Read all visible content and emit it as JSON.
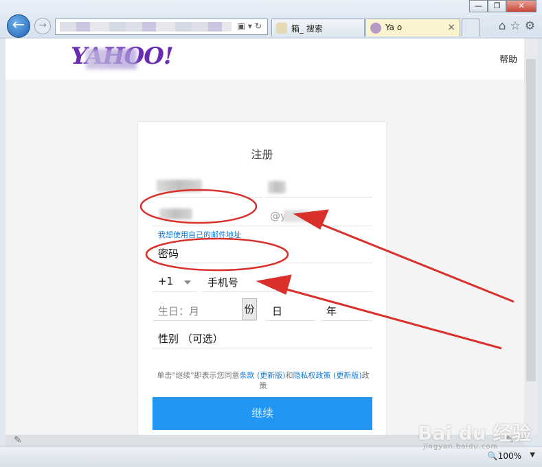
{
  "browser": {
    "window_buttons": [
      "—",
      "❐",
      "✕"
    ],
    "tabs": [
      {
        "label": "箱_  搜索",
        "active": false
      },
      {
        "label": "Ya   o",
        "active": true
      }
    ],
    "tab_close": "×",
    "tool_icons": [
      "home-icon",
      "star-icon",
      "gear-icon"
    ]
  },
  "header": {
    "logo_text": "YAHOO!",
    "help_label": "帮助",
    "brand_color": "#6a2bb3"
  },
  "form": {
    "title": "注册",
    "email_suffix": "@y    .com",
    "own_email_link": "我想使用自己的邮件地址",
    "password_placeholder": "密码",
    "country_code": "+1",
    "phone_placeholder": "手机号",
    "birth_month_placeholder": "生日：月",
    "birth_month_button": "份",
    "birth_day_placeholder": "日",
    "birth_year_placeholder": "年",
    "gender_placeholder": "性别 （可选）",
    "terms_prefix": "单击\"继续\"即表示您同意",
    "terms_link": "条款 (更新版)",
    "terms_mid": "和",
    "privacy_link": "隐私权政策 (更新版)",
    "terms_suffix": "政策",
    "continue_label": "继续",
    "button_color": "#2196f3"
  },
  "status": {
    "zoom_label": "100%"
  },
  "watermark": {
    "text": "Bai du 经验",
    "sub": "jingyan.baidu.com"
  },
  "annotation_color": "#d9302c"
}
